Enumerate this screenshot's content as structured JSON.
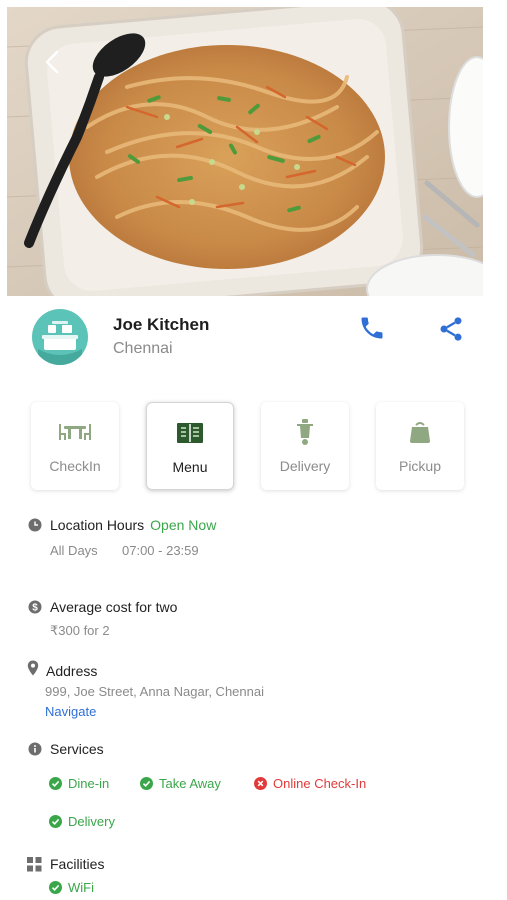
{
  "restaurant": {
    "name": "Joe Kitchen",
    "city": "Chennai"
  },
  "icons": {
    "back": "chevron-left-icon",
    "call": "phone-icon",
    "share": "share-icon"
  },
  "colors": {
    "accent_blue": "#2f6fd6",
    "open_green": "#3aa64a",
    "closed_red": "#e23a3a",
    "logo_teal": "#5bc3b8"
  },
  "actions": [
    {
      "label": "CheckIn",
      "icon": "table-icon",
      "active": false
    },
    {
      "label": "Menu",
      "icon": "menu-book-icon",
      "active": true
    },
    {
      "label": "Delivery",
      "icon": "scooter-icon",
      "active": false
    },
    {
      "label": "Pickup",
      "icon": "bag-icon",
      "active": false
    }
  ],
  "hours": {
    "title": "Location Hours",
    "status": "Open Now",
    "days": "All Days",
    "time": "07:00 - 23:59"
  },
  "cost": {
    "title": "Average cost for two",
    "value": "₹300 for 2"
  },
  "address": {
    "title": "Address",
    "line": "999, Joe Street, Anna Nagar, Chennai",
    "navigate": "Navigate"
  },
  "services": {
    "title": "Services",
    "items": [
      {
        "label": "Dine-in",
        "available": true
      },
      {
        "label": "Take Away",
        "available": true
      },
      {
        "label": "Online Check-In",
        "available": false
      },
      {
        "label": "Delivery",
        "available": true
      }
    ]
  },
  "facilities": {
    "title": "Facilities",
    "items": [
      {
        "label": "WiFi",
        "available": true
      }
    ]
  }
}
